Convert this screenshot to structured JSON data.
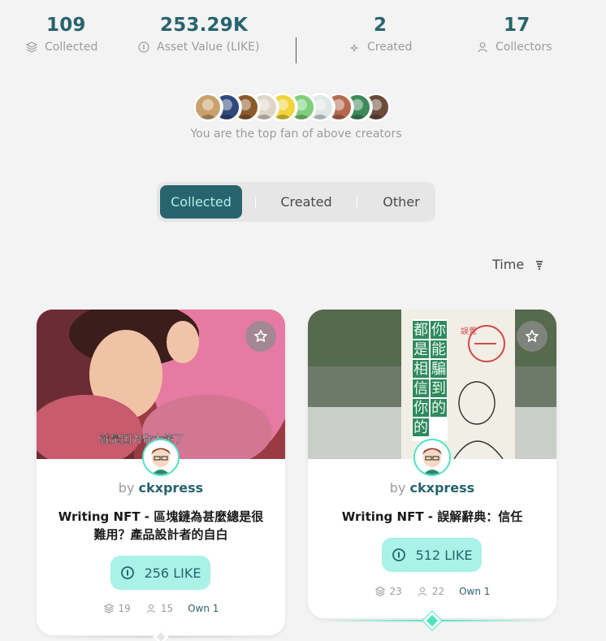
{
  "stats": {
    "collected": {
      "value": "109",
      "label": "Collected",
      "icon": "layers-icon"
    },
    "asset_value": {
      "value": "253.29K",
      "label": "Asset Value (LIKE)",
      "icon": "like-coin-icon"
    },
    "created": {
      "value": "2",
      "label": "Created",
      "icon": "sparkle-icon"
    },
    "collectors": {
      "value": "17",
      "label": "Collectors",
      "icon": "user-icon"
    }
  },
  "fans": {
    "text": "You are the top fan of above creators",
    "avatar_colors": [
      "#c8a16b",
      "#2f4a7a",
      "#8b5a2b",
      "#e0d6c8",
      "#f3d33b",
      "#7fcf7a",
      "#dfe8e6",
      "#b76a4f",
      "#3d8a5a",
      "#6b4b3a"
    ]
  },
  "tabs": [
    "Collected",
    "Created",
    "Other"
  ],
  "sort": {
    "label": "Time",
    "icon": "sort-icon"
  },
  "cards": [
    {
      "by": "by",
      "creator": "ckxpress",
      "title": "Writing NFT - 區塊鏈為甚麼總是很難用？產品設計者的自白",
      "price": "256 LIKE",
      "editions": "19",
      "collectors": "15",
      "own": "Own 1",
      "subtitle": "就是因为你太笨了"
    },
    {
      "by": "by",
      "creator": "ckxpress",
      "title": "Writing NFT - 誤解辭典：信任",
      "price": "512 LIKE",
      "editions": "23",
      "collectors": "22",
      "own": "Own 1",
      "poster_text": [
        "都",
        "你",
        "是",
        "能",
        "相",
        "騙",
        "信",
        "到",
        "你",
        "的",
        "的"
      ],
      "poster_tag": "誤覺"
    }
  ],
  "colors": {
    "accent": "#28646e",
    "mint": "#aaf1e7",
    "teal": "#50e3c2"
  }
}
